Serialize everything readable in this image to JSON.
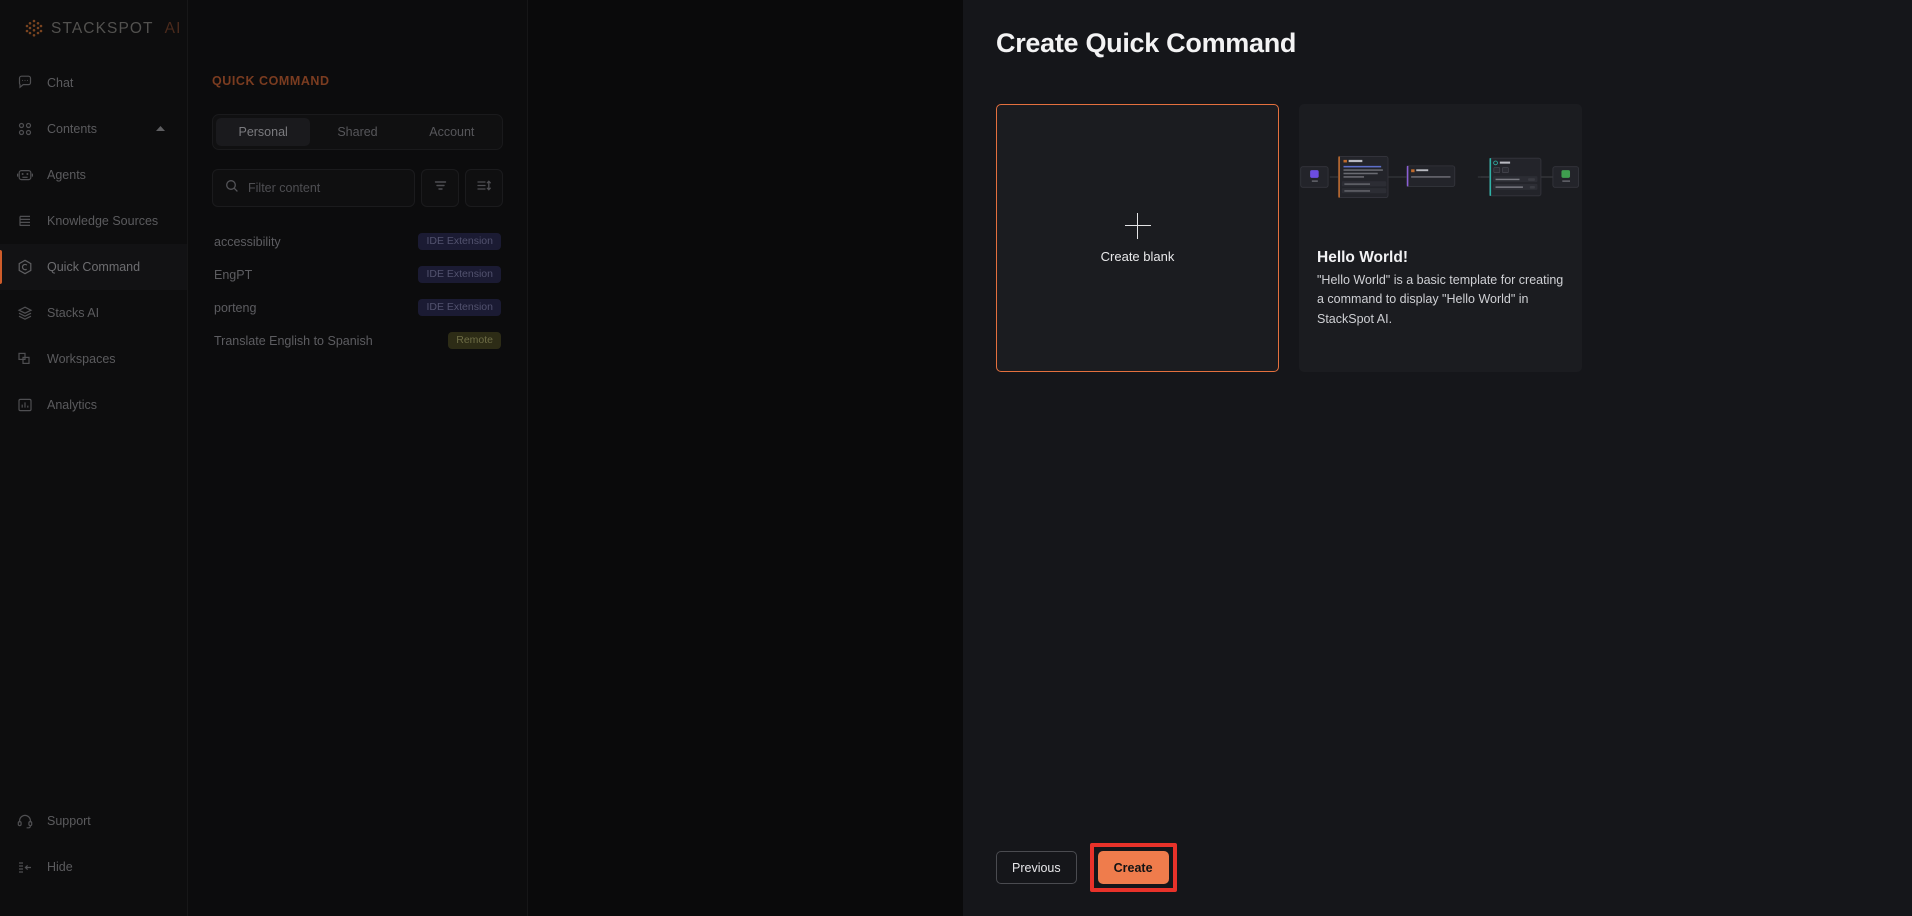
{
  "brand": {
    "name": "STACKSPOT",
    "suffix": "AI",
    "switcher_icon": "updown-chevron-icon"
  },
  "sidebar": {
    "items": [
      {
        "label": "Chat",
        "icon": "chat-icon",
        "active": false
      },
      {
        "label": "Contents",
        "icon": "grid-icon",
        "active": false,
        "caret": "▲"
      },
      {
        "label": "Agents",
        "icon": "robot-icon",
        "active": false
      },
      {
        "label": "Knowledge Sources",
        "icon": "books-icon",
        "active": false
      },
      {
        "label": "Quick Command",
        "icon": "hexagon-icon",
        "active": true
      },
      {
        "label": "Stacks AI",
        "icon": "layers-icon",
        "active": false
      },
      {
        "label": "Workspaces",
        "icon": "workspaces-icon",
        "active": false
      },
      {
        "label": "Analytics",
        "icon": "chart-icon",
        "active": false
      }
    ],
    "bottom_items": [
      {
        "label": "Support",
        "icon": "headset-icon"
      },
      {
        "label": "Hide",
        "icon": "collapse-icon"
      }
    ]
  },
  "list_panel": {
    "title": "QUICK COMMAND",
    "tabs": [
      {
        "label": "Personal",
        "active": true
      },
      {
        "label": "Shared",
        "active": false
      },
      {
        "label": "Account",
        "active": false
      }
    ],
    "search": {
      "placeholder": "Filter content",
      "value": "",
      "icon": "search-icon"
    },
    "filter_icon": "filter-icon",
    "sort_icon": "sort-icon",
    "commands": [
      {
        "name": "accessibility",
        "badge": "IDE Extension",
        "badge_kind": "ide"
      },
      {
        "name": "EngPT",
        "badge": "IDE Extension",
        "badge_kind": "ide"
      },
      {
        "name": "porteng",
        "badge": "IDE Extension",
        "badge_kind": "ide"
      },
      {
        "name": "Translate English to Spanish",
        "badge": "Remote",
        "badge_kind": "remote"
      }
    ]
  },
  "modal": {
    "title": "Create Quick Command",
    "blank_card": {
      "label": "Create blank",
      "icon": "plus-icon",
      "selected": true
    },
    "template_card": {
      "title": "Hello World!",
      "description": "\"Hello World\" is a basic template for creating a command to display \"Hello World\" in StackSpot AI.",
      "thumbnail": "flow-diagram-thumbnail"
    },
    "footer": {
      "previous_label": "Previous",
      "create_label": "Create",
      "create_highlighted": true
    }
  },
  "colors": {
    "accent_orange": "#ef7c4c",
    "highlight_red": "#e8322a",
    "card_border_selected": "#e4703e",
    "panel_bg": "#15161a",
    "app_bg": "#0c0c0d",
    "badge_ide_bg": "#1b1b33",
    "badge_remote_bg": "#2d2c16"
  }
}
